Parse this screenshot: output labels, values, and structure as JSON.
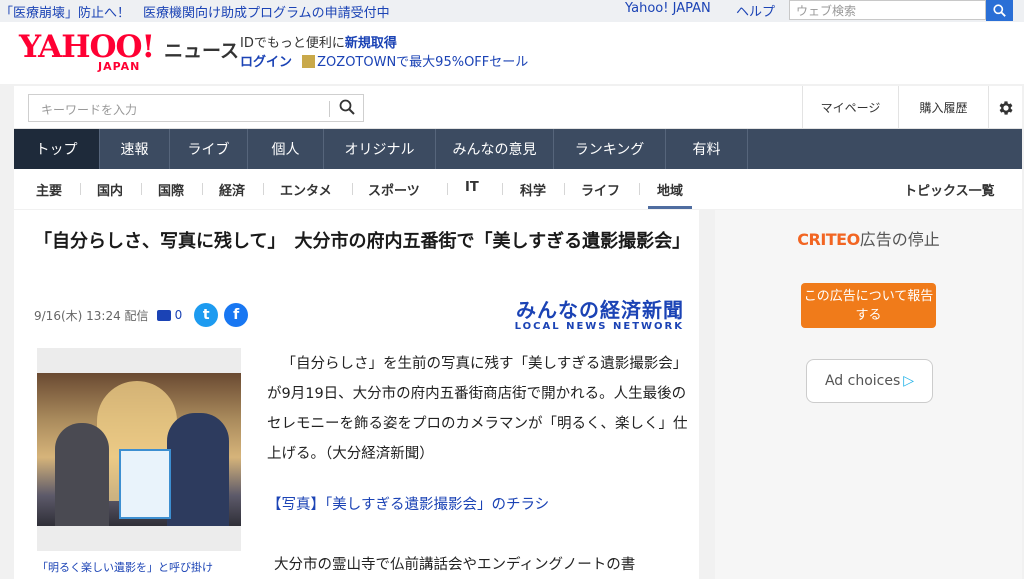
{
  "topbar": {
    "promo": "「医療崩壊」防止へ！　医療機関向け助成プログラムの申請受付中",
    "yahoo_japan": "Yahoo! JAPAN",
    "help": "ヘルプ",
    "search_placeholder": "ウェブ検索"
  },
  "header": {
    "logo_text": "YAHOO!",
    "logo_sub": "JAPAN",
    "section": "ニュース",
    "id_text": "IDでもっと便利に",
    "id_link": "新規取得",
    "login": "ログイン",
    "zozo": "ZOZOTOWNで最大95%OFFセール"
  },
  "util": {
    "keyword_placeholder": "キーワードを入力",
    "mypage": "マイページ",
    "history": "購入履歴"
  },
  "mainnav": [
    {
      "label": "トップ",
      "active": true
    },
    {
      "label": "速報"
    },
    {
      "label": "ライブ"
    },
    {
      "label": "個人"
    },
    {
      "label": "オリジナル"
    },
    {
      "label": "みんなの意見"
    },
    {
      "label": "ランキング"
    },
    {
      "label": "有料"
    }
  ],
  "subnav": {
    "items": [
      "主要",
      "国内",
      "国際",
      "経済",
      "エンタメ",
      "スポーツ",
      "IT",
      "科学",
      "ライフ",
      "地域"
    ],
    "active": "地域",
    "topics": "トピックス一覧"
  },
  "article": {
    "title": "「自分らしさ、写真に残して」　大分市の府内五番街で「美しすぎる遺影撮影会」",
    "date": "9/16(木) 13:24",
    "delivered": "配信",
    "comments": "0",
    "source_name": "みんなの経済新聞",
    "source_sub": "LOCAL NEWS NETWORK",
    "caption": "「明るく楽しい遺影を」と呼び掛け",
    "paragraph": "「自分らしさ」を生前の写真に残す「美しすぎる遺影撮影会」が9月19日、大分市の府内五番街商店街で開かれる。人生最後のセレモニーを飾る姿をプロのカメラマンが「明るく、楽しく」仕上げる。（大分経済新聞）",
    "photo_link": "【写真】「美しすぎる遺影撮影会」のチラシ",
    "paragraph2": "大分市の霊山寺で仏前講話会やエンディングノートの書"
  },
  "ad": {
    "criteo": "CRITEO",
    "stop": "広告の停止",
    "about_btn": "この広告について報告する",
    "adchoices": "Ad choices"
  }
}
